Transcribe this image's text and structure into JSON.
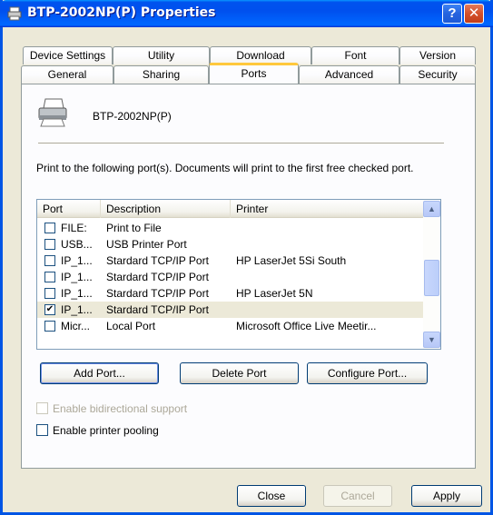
{
  "window": {
    "title": "BTP-2002NP(P) Properties"
  },
  "titlebar": {
    "help_label": "?",
    "close_label": "✕"
  },
  "tabs_back": [
    {
      "label": "Device Settings"
    },
    {
      "label": "Utility"
    },
    {
      "label": "Download"
    },
    {
      "label": "Font"
    },
    {
      "label": "Version"
    }
  ],
  "tabs_front": [
    {
      "label": "General"
    },
    {
      "label": "Sharing"
    },
    {
      "label": "Ports"
    },
    {
      "label": "Advanced"
    },
    {
      "label": "Security"
    }
  ],
  "printer": {
    "name": "BTP-2002NP(P)"
  },
  "description": "Print to the following port(s). Documents will print to the first free checked port.",
  "ports_table": {
    "headers": [
      "Port",
      "Description",
      "Printer"
    ],
    "rows": [
      {
        "checked": false,
        "port": "FILE:",
        "description": "Print to File",
        "printer": ""
      },
      {
        "checked": false,
        "port": "USB...",
        "description": "USB Printer Port",
        "printer": ""
      },
      {
        "checked": false,
        "port": "IP_1...",
        "description": "Stardard TCP/IP Port",
        "printer": "HP LaserJet 5Si South"
      },
      {
        "checked": false,
        "port": "IP_1...",
        "description": "Stardard TCP/IP Port",
        "printer": ""
      },
      {
        "checked": false,
        "port": "IP_1...",
        "description": "Stardard TCP/IP Port",
        "printer": "HP LaserJet 5N"
      },
      {
        "checked": true,
        "port": "IP_1...",
        "description": "Stardard TCP/IP Port",
        "printer": ""
      },
      {
        "checked": false,
        "port": "Micr...",
        "description": "Local Port",
        "printer": "Microsoft Office Live Meetir..."
      }
    ],
    "selected_index": 5
  },
  "buttons": {
    "add_port": "Add Port...",
    "delete_port": "Delete Port",
    "configure_port": "Configure Port..."
  },
  "options": {
    "bidirectional": "Enable bidirectional support",
    "pooling": "Enable printer pooling"
  },
  "footer": {
    "close": "Close",
    "cancel": "Cancel",
    "apply": "Apply"
  },
  "colors": {
    "titlebar": "#0054e3",
    "dialog_bg": "#ece9d8",
    "active_tab_accent": "#ffc83c"
  }
}
